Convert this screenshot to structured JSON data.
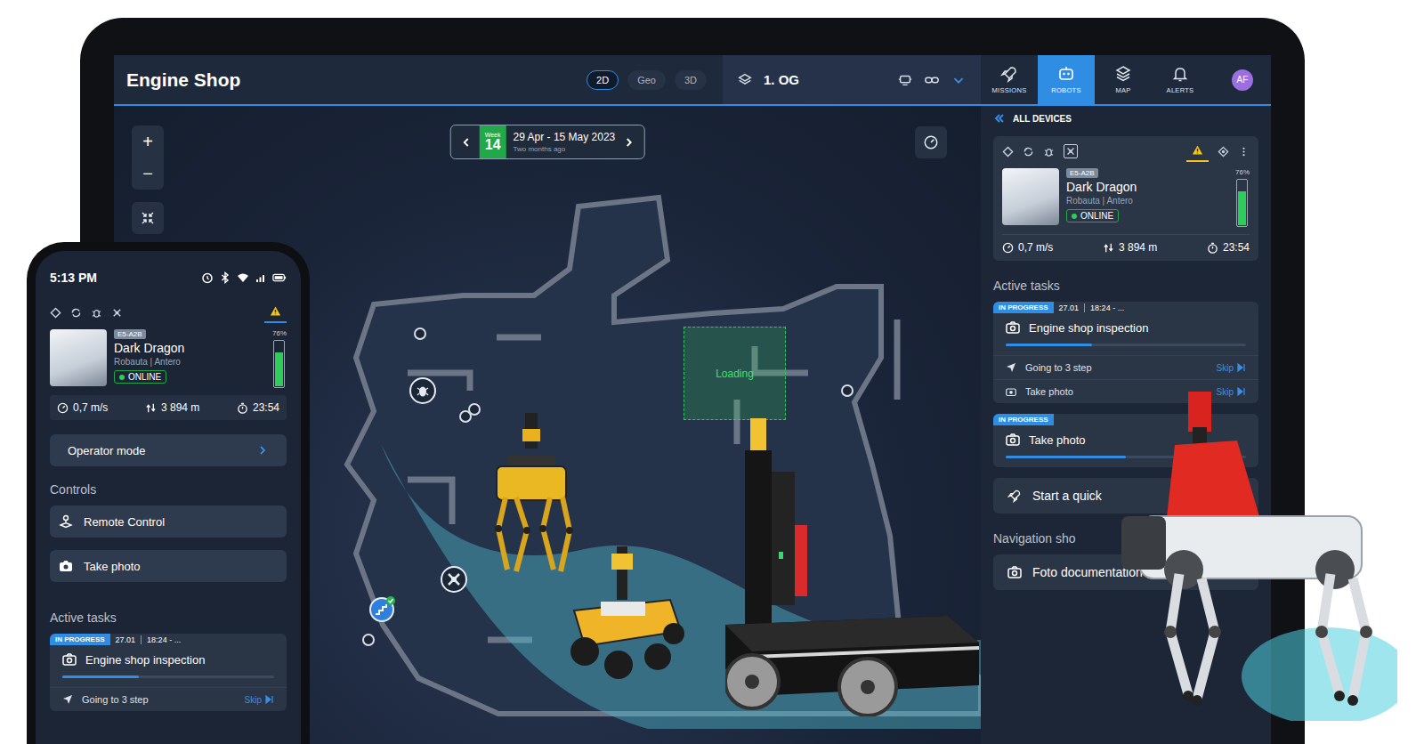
{
  "tablet": {
    "title": "Engine Shop",
    "view_modes": [
      {
        "label": "2D",
        "selected": true
      },
      {
        "label": "Geo",
        "selected": false
      },
      {
        "label": "3D",
        "selected": false
      }
    ],
    "floor": "1. OG",
    "nav": [
      {
        "label": "MISSIONS",
        "kind": "missions",
        "selected": false
      },
      {
        "label": "ROBOTS",
        "kind": "robots",
        "selected": true
      },
      {
        "label": "MAP",
        "kind": "map",
        "selected": false
      },
      {
        "label": "ALERTS",
        "kind": "alerts",
        "selected": false
      }
    ],
    "avatar": "AF"
  },
  "map": {
    "zoom_in": "+",
    "zoom_out": "−",
    "week": {
      "label": "Week",
      "number": "14",
      "range": "29 Apr - 15 May 2023",
      "ago": "Two months ago"
    },
    "loading": "Loading"
  },
  "device": {
    "badge": "E5-A2B",
    "name": "Dark Dragon",
    "vendor": "Robauta | Antero",
    "status": "ONLINE",
    "online": true,
    "battery": "76%",
    "battery_level": 0.76,
    "speed": "0,7 m/s",
    "distance": "3 894 m",
    "time": "23:54"
  },
  "panel": {
    "title": "ALL DEVICES",
    "active_tasks_title": "Active tasks",
    "tasks": [
      {
        "status": "IN PROGRESS",
        "date": "27.01",
        "time": "18:24 - ...",
        "title": "Engine shop inspection",
        "level": 0.36,
        "steps": [
          {
            "label": "Going to 3 step",
            "kind": "navigate",
            "action": "Skip"
          },
          {
            "label": "Take photo",
            "kind": "photo",
            "action": "Skip"
          }
        ]
      },
      {
        "status": "IN PROGRESS",
        "title": "Take photo",
        "level": 0.5,
        "steps": []
      }
    ],
    "quick_mission": "Start a quick",
    "navigation_title": "Navigation sho",
    "shortcuts": [
      {
        "label": "Foto documentation"
      }
    ]
  },
  "phone": {
    "time": "5:13 PM",
    "operator_mode": "Operator mode",
    "controls_title": "Controls",
    "controls": [
      {
        "label": "Remote Control",
        "kind": "remote"
      },
      {
        "label": "Take photo",
        "kind": "photo"
      }
    ],
    "active_tasks_title": "Active tasks",
    "tasks": [
      {
        "status": "IN PROGRESS",
        "date": "27.01",
        "time": "18:24 - ...",
        "title": "Engine shop inspection",
        "level": 0.36,
        "steps": [
          {
            "label": "Going to 3 step",
            "kind": "navigate",
            "action": "Skip"
          }
        ]
      }
    ]
  }
}
